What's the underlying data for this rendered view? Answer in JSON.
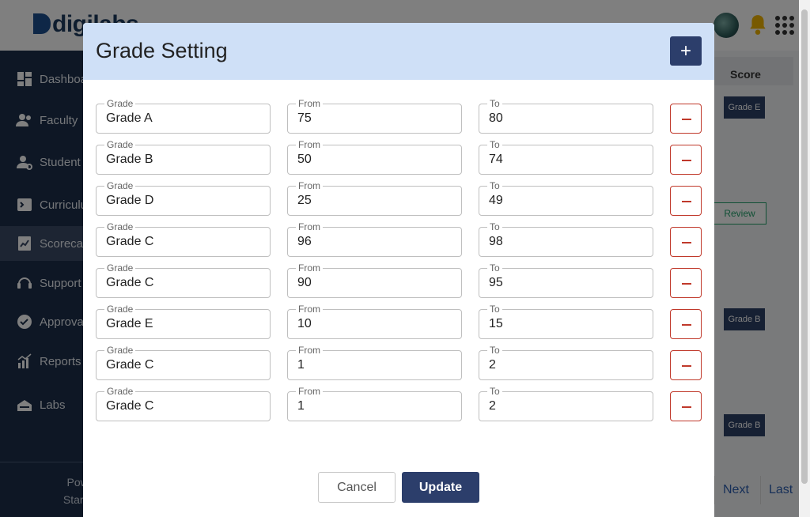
{
  "app": {
    "logo_text": "digilabs",
    "brand_color": "#1d3a5f",
    "accent_color": "#2c3e6b"
  },
  "sidebar": {
    "items": [
      {
        "label": "Dashboard",
        "icon": "dashboard-icon"
      },
      {
        "label": "Faculty",
        "icon": "faculty-icon"
      },
      {
        "label": "Student Management",
        "icon": "student-icon"
      },
      {
        "label": "Curriculum",
        "icon": "curriculum-icon"
      },
      {
        "label": "Scorecard",
        "icon": "scorecard-icon",
        "active": true
      },
      {
        "label": "Support",
        "icon": "headset-icon"
      },
      {
        "label": "Approvals",
        "icon": "check-circle-icon"
      },
      {
        "label": "Reports",
        "icon": "reports-icon"
      },
      {
        "label": "Labs",
        "icon": "labs-icon"
      }
    ],
    "powered_by": "Powered by",
    "company": "Star Systems"
  },
  "background": {
    "column_header": "Score",
    "chips": [
      "Grade E",
      "Grade B",
      "Grade B"
    ],
    "review_label": "Review",
    "pager": {
      "next": "Next",
      "last": "Last"
    }
  },
  "modal": {
    "title": "Grade Setting",
    "add_label": "+",
    "grade_label": "Grade",
    "from_label": "From",
    "to_label": "To",
    "rows": [
      {
        "grade": "Grade A",
        "from": "75",
        "to": "80"
      },
      {
        "grade": "Grade B",
        "from": "50",
        "to": "74"
      },
      {
        "grade": "Grade D",
        "from": "25",
        "to": "49"
      },
      {
        "grade": "Grade C",
        "from": "96",
        "to": "98"
      },
      {
        "grade": "Grade C",
        "from": "90",
        "to": "95"
      },
      {
        "grade": "Grade E",
        "from": "10",
        "to": "15"
      },
      {
        "grade": "Grade C",
        "from": "1",
        "to": "2"
      },
      {
        "grade": "Grade C",
        "from": "1",
        "to": "2"
      }
    ],
    "cancel_label": "Cancel",
    "update_label": "Update"
  }
}
